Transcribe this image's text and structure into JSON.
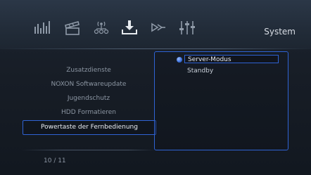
{
  "header": {
    "title": "System",
    "icons": [
      "equalizer-icon",
      "clapperboard-icon",
      "wireless-network-icon",
      "download-icon",
      "arrow-forward-icon",
      "sliders-icon"
    ]
  },
  "menu": {
    "items": [
      {
        "label": "Zusatzdienste"
      },
      {
        "label": "NOXON Softwareupdate"
      },
      {
        "label": "Jugendschutz"
      },
      {
        "label": "HDD Formatieren"
      },
      {
        "label": "Powertaste der Fernbedienung",
        "selected": true
      }
    ]
  },
  "options": {
    "items": [
      {
        "label": "Server-Modus",
        "selected": true
      },
      {
        "label": "Standby"
      }
    ]
  },
  "footer": {
    "pager": "10 / 11"
  },
  "colors": {
    "accent": "#2f63d4",
    "text_primary": "#e8edf3",
    "text_secondary": "#8c96a3",
    "background": "#171d26"
  }
}
